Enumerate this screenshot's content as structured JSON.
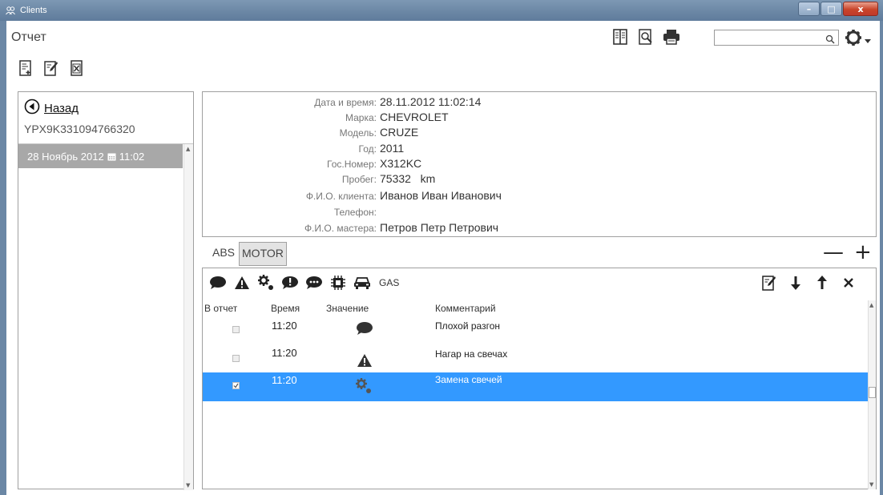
{
  "window": {
    "title": "Clients",
    "minimize_label": "–",
    "maximize_label": "□",
    "close_label": "x"
  },
  "page": {
    "title": "Отчет"
  },
  "search": {
    "value": "",
    "placeholder": ""
  },
  "sidebar": {
    "back_label": "Назад",
    "vin": "YPX9K331094766320",
    "dates": [
      {
        "date": "28 Ноябрь 2012",
        "time": "11:02"
      }
    ]
  },
  "info": {
    "rows": [
      {
        "label": "Дата и время:",
        "value": "28.11.2012 11:02:14"
      },
      {
        "label": "Марка:",
        "value": "CHEVROLET"
      },
      {
        "label": "Модель:",
        "value": "CRUZE"
      },
      {
        "label": "Год:",
        "value": "2011"
      },
      {
        "label": "Гос.Номер:",
        "value": "X312KC"
      },
      {
        "label": "Пробег:",
        "value": "75332   km"
      },
      {
        "label": "Ф.И.О. клиента:",
        "value": "Иванов Иван Иванович"
      },
      {
        "label": "Телефон:",
        "value": ""
      },
      {
        "label": "Ф.И.О. мастера:",
        "value": "Петров Петр Петрович"
      }
    ]
  },
  "tabs": [
    {
      "label": "ABS",
      "active": false
    },
    {
      "label": "MOTOR",
      "active": true
    }
  ],
  "controls": {
    "minus": "—",
    "plus": "+"
  },
  "event_toolbar": {
    "gas_label": "GAS"
  },
  "table": {
    "headers": [
      "В отчет",
      "Время",
      "Значение",
      "Комментарий"
    ],
    "rows": [
      {
        "checked": false,
        "time": "11:20",
        "icon": "comment-icon",
        "comment": "Плохой разгон",
        "selected": false
      },
      {
        "checked": false,
        "time": "11:20",
        "icon": "warning-icon",
        "comment": "Нагар на свечах",
        "selected": false
      },
      {
        "checked": true,
        "time": "11:20",
        "icon": "gears-icon",
        "comment": "Замена свечей",
        "selected": true
      }
    ]
  },
  "colors": {
    "selection": "#3399ff",
    "titlebar": "#6a86a4",
    "date_item": "#a8a8a8"
  }
}
